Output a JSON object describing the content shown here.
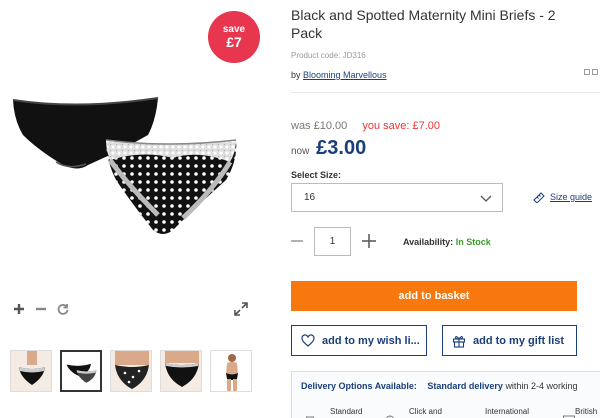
{
  "badge": {
    "line1": "save",
    "line2": "£7"
  },
  "product": {
    "title": "Black and Spotted Maternity Mini Briefs - 2 Pack",
    "code": "Product code: JD316",
    "by_prefix": "by",
    "brand": "Blooming Marvellous"
  },
  "pricing": {
    "was": "was £10.00",
    "you_save": "you save: £7.00",
    "now_label": "now",
    "now_price": "£3.00"
  },
  "size": {
    "label": "Select Size:",
    "selected": "16",
    "guide": "Size guide"
  },
  "quantity": {
    "value": "1"
  },
  "availability": {
    "label": "Availability:",
    "status": "In Stock"
  },
  "buttons": {
    "basket": "add to basket",
    "wish": "add to my wish li...",
    "gift": "add to my gift list"
  },
  "delivery": {
    "title": "Delivery Options Available:",
    "standard": "Standard delivery",
    "within": "within 2-4 working",
    "options": [
      "Standard",
      "Click and",
      "International",
      "British"
    ]
  },
  "colors": {
    "accent_blue": "#1a3e7a",
    "save_red": "#e8364f",
    "basket_orange": "#f6780f",
    "stock_green": "#3a9a2a"
  },
  "icons": [
    "zoom-in-icon",
    "zoom-out-icon",
    "rotate-icon",
    "expand-icon",
    "chevron-down-icon",
    "ruler-icon",
    "minus-icon",
    "plus-icon",
    "heart-icon",
    "gift-icon",
    "truck-icon",
    "store-icon",
    "globe-icon",
    "flag-icon"
  ]
}
